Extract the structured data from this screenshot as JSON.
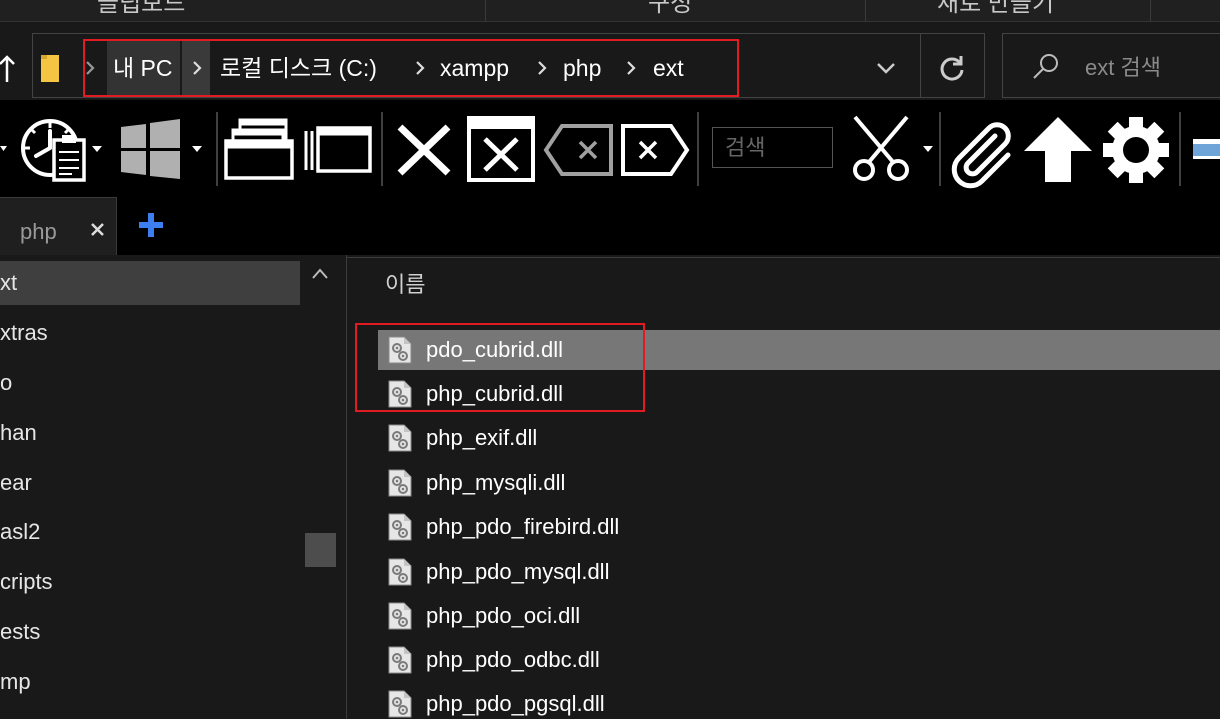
{
  "ribbon": {
    "groups": [
      "클립보드",
      "구성",
      "새로 만들기"
    ]
  },
  "address_bar": {
    "segments": [
      "내 PC",
      "로컬 디스크 (C:)",
      "xampp",
      "php",
      "ext"
    ],
    "search_placeholder": "ext 검색"
  },
  "toolbar": {
    "search_placeholder": "검색"
  },
  "tabs": [
    {
      "label": "php"
    }
  ],
  "nav_pane": {
    "items": [
      "xt",
      "xtras",
      "o",
      "han",
      "ear",
      "asl2",
      "cripts",
      "ests",
      "mp"
    ],
    "selected_index": 0
  },
  "file_list": {
    "column_header": "이름",
    "files": [
      "pdo_cubrid.dll",
      "php_cubrid.dll",
      "php_exif.dll",
      "php_mysqli.dll",
      "php_pdo_firebird.dll",
      "php_pdo_mysql.dll",
      "php_pdo_oci.dll",
      "php_pdo_odbc.dll",
      "php_pdo_pgsql.dll"
    ],
    "selected_index": 0
  },
  "icons": {
    "address": [
      "up-arrow-icon",
      "folder-icon",
      "chevron-right-icon",
      "chevron-down-icon",
      "refresh-icon",
      "search-icon"
    ],
    "toolbar": [
      "properties-icon",
      "windows-icon",
      "cascade-windows-icon",
      "window-icon",
      "close-icon",
      "close-window-icon",
      "backspace-icon",
      "delete-icon",
      "scissors-icon",
      "paperclip-icon",
      "up-arrow-icon",
      "gear-icon"
    ],
    "tabs": [
      "close-icon",
      "plus-icon"
    ],
    "files": "dll-file-icon"
  },
  "colors": {
    "highlight_box": "#e01b22",
    "selected_row": "#777777",
    "nav_selected": "#3f3f3f",
    "accent_blue": "#3d7ff0",
    "folder": "#f4c542"
  }
}
